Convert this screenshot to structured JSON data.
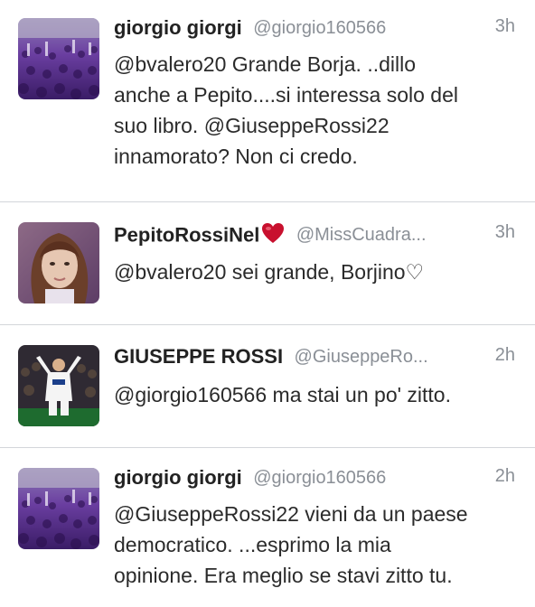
{
  "tweets": [
    {
      "name": "giorgio giorgi",
      "handle": "@giorgio160566",
      "time": "3h",
      "text": "@bvalero20 Grande Borja. ..dillo\nanche a Pepito....si interessa solo del\nsuo libro. @GiuseppeRossi22\ninnamorato? Non ci credo.",
      "avatar": "crowd-avatar"
    },
    {
      "name": "PepitoRossiNel",
      "handle": "@MissCuadra...",
      "time": "3h",
      "text": "@bvalero20 sei grande, Borjino♡",
      "avatar": "girl-avatar"
    },
    {
      "name": "GIUSEPPE ROSSI",
      "handle": "@GiuseppeRo...",
      "time": "2h",
      "text": "@giorgio160566 ma stai un po' zitto.",
      "avatar": "player-avatar"
    },
    {
      "name": "giorgio giorgi",
      "handle": "@giorgio160566",
      "time": "2h",
      "text": "@GiuseppeRossi22 vieni da un paese\ndemocratico. ...esprimo la mia\nopinione. Era meglio se stavi zitto tu.",
      "avatar": "crowd-avatar"
    }
  ],
  "colors": {
    "name": "#222222",
    "meta": "#8a8f96",
    "body": "#2b2b2b",
    "divider": "#d3d6da",
    "heart": "#c8102e"
  }
}
